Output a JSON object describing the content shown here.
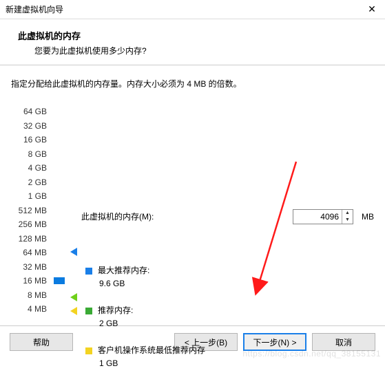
{
  "window": {
    "title": "新建虚拟机向导",
    "close": "✕"
  },
  "header": {
    "title": "此虚拟机的内存",
    "subtitle": "您要为此虚拟机使用多少内存?"
  },
  "instruction": "指定分配给此虚拟机的内存量。内存大小必须为 4 MB 的倍数。",
  "memory": {
    "label": "此虚拟机的内存(M):",
    "value": "4096",
    "unit": "MB"
  },
  "scale": [
    "64 GB",
    "32 GB",
    "16 GB",
    "8 GB",
    "4 GB",
    "2 GB",
    "1 GB",
    "512 MB",
    "256 MB",
    "128 MB",
    "64 MB",
    "32 MB",
    "16 MB",
    "8 MB",
    "4 MB"
  ],
  "legend": {
    "max": {
      "label": "最大推荐内存:",
      "value": "9.6 GB"
    },
    "rec": {
      "label": "推荐内存:",
      "value": "2 GB"
    },
    "min": {
      "label": "客户机操作系统最低推荐内存",
      "value": "1 GB"
    }
  },
  "buttons": {
    "help": "帮助",
    "back": "< 上一步(B)",
    "next": "下一步(N) >",
    "cancel": "取消"
  },
  "watermark": "https://blog.csdn.net/qq_38155131"
}
